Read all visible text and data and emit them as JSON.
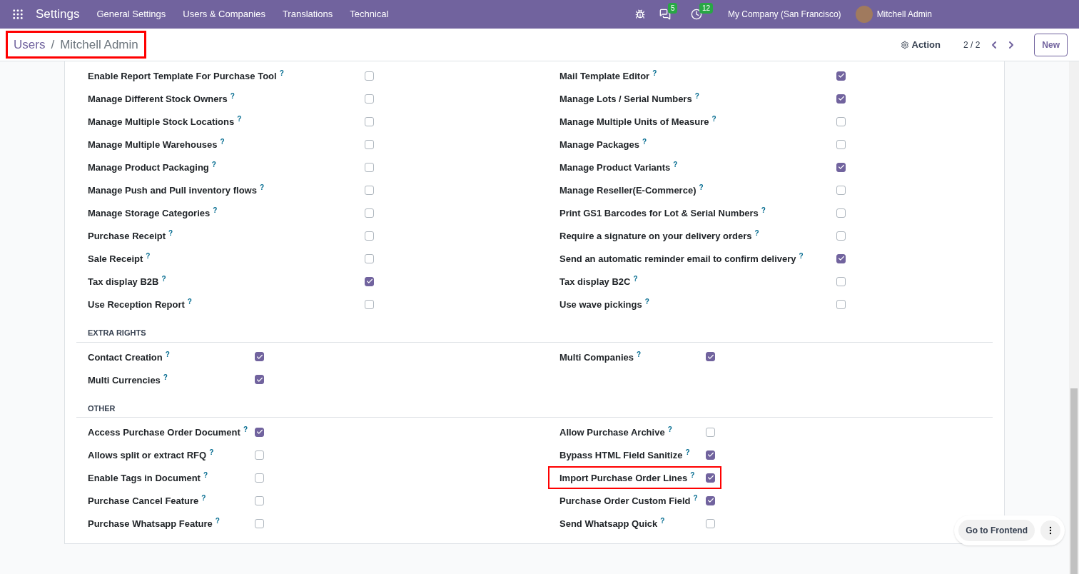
{
  "navbar": {
    "app": "Settings",
    "menu": [
      "General Settings",
      "Users & Companies",
      "Translations",
      "Technical"
    ],
    "messages_badge": "5",
    "activities_badge": "12",
    "company": "My Company (San Francisco)",
    "user": "Mitchell Admin"
  },
  "control_panel": {
    "breadcrumb": [
      {
        "label": "Users",
        "link": true
      },
      {
        "label": "/",
        "link": false
      },
      {
        "label": "Mitchell Admin",
        "link": false
      }
    ],
    "breadcrumb_highlighted": true,
    "action": "Action",
    "pager": "2 / 2",
    "new_button": "New"
  },
  "sections": [
    {
      "kind": "aligned",
      "left": [
        {
          "label": "Enable Report Template For Purchase Tool",
          "help": "?",
          "checked": false,
          "highlighted": false
        },
        {
          "label": "Manage Different Stock Owners",
          "help": "?",
          "checked": false,
          "highlighted": false
        },
        {
          "label": "Manage Multiple Stock Locations",
          "help": "?",
          "checked": false,
          "highlighted": false
        },
        {
          "label": "Manage Multiple Warehouses",
          "help": "?",
          "checked": false,
          "highlighted": false
        },
        {
          "label": "Manage Product Packaging",
          "help": "?",
          "checked": false,
          "highlighted": false
        },
        {
          "label": "Manage Push and Pull inventory flows",
          "help": "?",
          "checked": false,
          "highlighted": false
        },
        {
          "label": "Manage Storage Categories",
          "help": "?",
          "checked": false,
          "highlighted": false
        },
        {
          "label": "Purchase Receipt",
          "help": "?",
          "checked": false,
          "highlighted": false
        },
        {
          "label": "Sale Receipt",
          "help": "?",
          "checked": false,
          "highlighted": false
        },
        {
          "label": "Tax display B2B",
          "help": "?",
          "checked": true,
          "highlighted": false
        },
        {
          "label": "Use Reception Report",
          "help": "?",
          "checked": false,
          "highlighted": false
        }
      ],
      "right": [
        {
          "label": "Mail Template Editor",
          "help": "?",
          "checked": true,
          "highlighted": false
        },
        {
          "label": "Manage Lots / Serial Numbers",
          "help": "?",
          "checked": true,
          "highlighted": false
        },
        {
          "label": "Manage Multiple Units of Measure",
          "help": "?",
          "checked": false,
          "highlighted": false
        },
        {
          "label": "Manage Packages",
          "help": "?",
          "checked": false,
          "highlighted": false
        },
        {
          "label": "Manage Product Variants",
          "help": "?",
          "checked": true,
          "highlighted": false
        },
        {
          "label": "Manage Reseller(E-Commerce)",
          "help": "?",
          "checked": false,
          "highlighted": false
        },
        {
          "label": "Print GS1 Barcodes for Lot & Serial Numbers",
          "help": "?",
          "checked": false,
          "highlighted": false
        },
        {
          "label": "Require a signature on your delivery orders",
          "help": "?",
          "checked": false,
          "highlighted": false
        },
        {
          "label": "Send an automatic reminder email to confirm delivery",
          "help": "?",
          "checked": true,
          "highlighted": false
        },
        {
          "label": "Tax display B2C",
          "help": "?",
          "checked": false,
          "highlighted": false
        },
        {
          "label": "Use wave pickings",
          "help": "?",
          "checked": false,
          "highlighted": false
        }
      ]
    },
    {
      "title": "EXTRA RIGHTS",
      "kind": "inline",
      "left": [
        {
          "label": "Contact Creation",
          "help": "?",
          "checked": true,
          "highlighted": false
        },
        {
          "label": "Multi Currencies",
          "help": "?",
          "checked": true,
          "highlighted": false
        }
      ],
      "right": [
        {
          "label": "Multi Companies",
          "help": "?",
          "checked": true,
          "highlighted": false
        }
      ]
    },
    {
      "title": "OTHER",
      "kind": "inline",
      "left": [
        {
          "label": "Access Purchase Order Document",
          "help": "?",
          "checked": true,
          "highlighted": false
        },
        {
          "label": "Allows split or extract RFQ",
          "help": "?",
          "checked": false,
          "highlighted": false
        },
        {
          "label": "Enable Tags in Document",
          "help": "?",
          "checked": false,
          "highlighted": false
        },
        {
          "label": "Purchase Cancel Feature",
          "help": "?",
          "checked": false,
          "highlighted": false
        },
        {
          "label": "Purchase Whatsapp Feature",
          "help": "?",
          "checked": false,
          "highlighted": false
        }
      ],
      "right": [
        {
          "label": "Allow Purchase Archive",
          "help": "?",
          "checked": false,
          "highlighted": false
        },
        {
          "label": "Bypass HTML Field Sanitize",
          "help": "?",
          "checked": true,
          "highlighted": false
        },
        {
          "label": "Import Purchase Order Lines",
          "help": "?",
          "checked": true,
          "highlighted": true
        },
        {
          "label": "Purchase Order Custom Field",
          "help": "?",
          "checked": true,
          "highlighted": false
        },
        {
          "label": "Send Whatsapp Quick",
          "help": "?",
          "checked": false,
          "highlighted": false
        }
      ]
    }
  ],
  "floating": {
    "button": "Go to Frontend"
  }
}
